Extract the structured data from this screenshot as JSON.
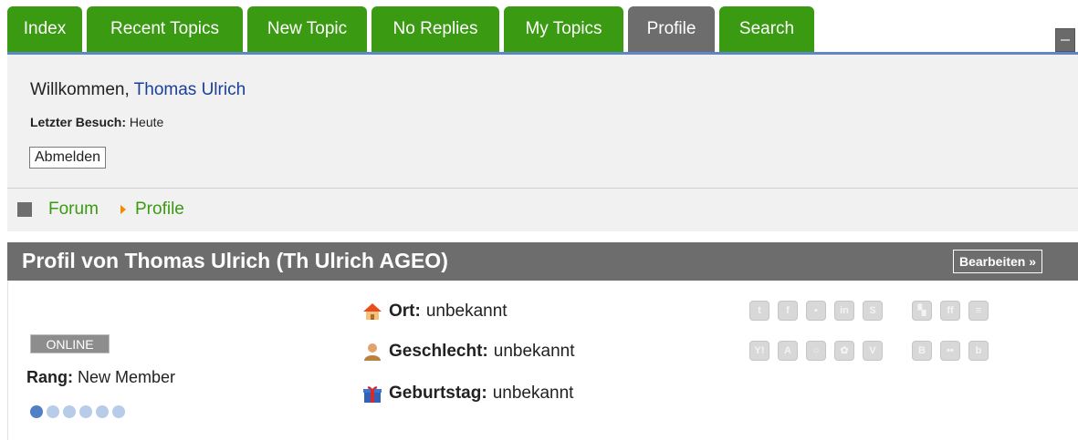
{
  "tabs": [
    {
      "label": "Index",
      "active": false
    },
    {
      "label": "Recent Topics",
      "active": false
    },
    {
      "label": "New Topic",
      "active": false
    },
    {
      "label": "No Replies",
      "active": false
    },
    {
      "label": "My Topics",
      "active": false
    },
    {
      "label": "Profile",
      "active": true
    },
    {
      "label": "Search",
      "active": false
    }
  ],
  "welcome": {
    "greeting": "Willkommen,",
    "username": "Thomas Ulrich",
    "last_visit_label": "Letzter Besuch:",
    "last_visit_value": "Heute",
    "logout_label": "Abmelden"
  },
  "breadcrumb": {
    "forum": "Forum",
    "current": "Profile"
  },
  "profile": {
    "title": "Profil von Thomas Ulrich (Th Ulrich AGEO)",
    "edit_label": "Bearbeiten »",
    "status": "ONLINE",
    "rank_label": "Rang:",
    "rank_value": "New Member",
    "rank_level": 1,
    "rank_max": 6,
    "location_label": "Ort:",
    "location_value": "unbekannt",
    "gender_label": "Geschlecht:",
    "gender_value": "unbekannt",
    "birthday_label": "Geburtstag:",
    "birthday_value": "unbekannt"
  },
  "social_icons": {
    "row1": [
      "twitter-icon",
      "facebook-icon",
      "myspace-icon",
      "linkedin-icon",
      "skype-icon",
      "delicious-icon",
      "friendfeed-icon",
      "digg-icon"
    ],
    "row2": [
      "yim-icon",
      "aim-icon",
      "icq-icon",
      "gtalk-icon",
      "vk-icon",
      "blogger-icon",
      "flickr-icon",
      "bebo-icon"
    ]
  },
  "colors": {
    "tab_green": "#3a9a12",
    "tab_active": "#6d6d6d",
    "link_blue": "#1b3f97",
    "accent_line": "#5f87c8"
  }
}
